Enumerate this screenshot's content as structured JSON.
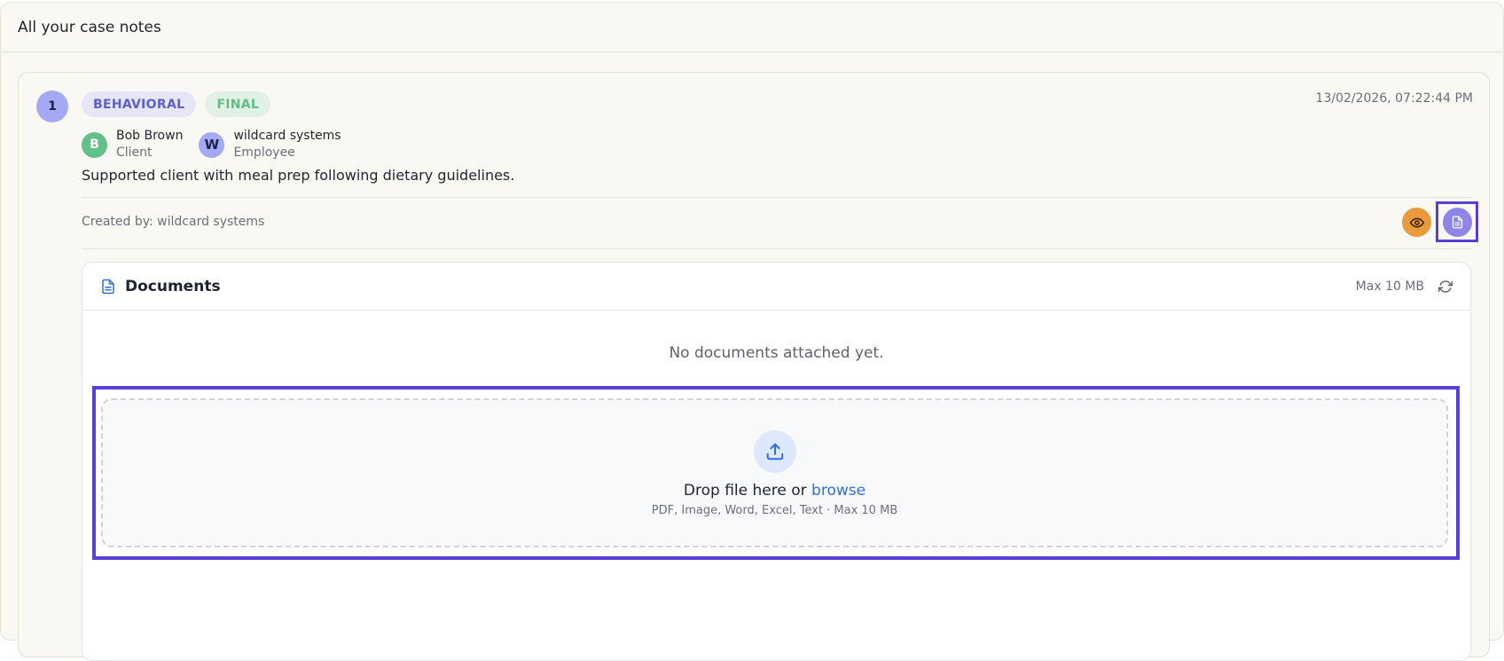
{
  "panel": {
    "title": "All your case notes"
  },
  "note": {
    "number": "1",
    "badges": {
      "type": "BEHAVIORAL",
      "status": "FINAL"
    },
    "timestamp": "13/02/2026, 07:22:44 PM",
    "people": [
      {
        "initial": "B",
        "name": "Bob Brown",
        "role": "Client"
      },
      {
        "initial": "W",
        "name": "wildcard systems",
        "role": "Employee"
      }
    ],
    "body": "Supported client with meal prep following dietary guidelines.",
    "created_by": "Created by: wildcard systems",
    "actions": {
      "view_icon": "eye-icon",
      "document_icon": "document-icon"
    }
  },
  "documents": {
    "title": "Documents",
    "max_size": "Max 10 MB",
    "empty_message": "No documents attached yet.",
    "dropzone": {
      "prompt": "Drop file here or",
      "browse_label": "browse",
      "hint": "PDF, Image, Word, Excel, Text · Max 10 MB"
    }
  },
  "colors": {
    "accent": "#5a3fd6",
    "badge_type": "#5a5fd2",
    "badge_status": "#5fbf86",
    "view_button": "#ea9a3a",
    "document_button": "#8d85e8",
    "link": "#2f6fe0"
  }
}
